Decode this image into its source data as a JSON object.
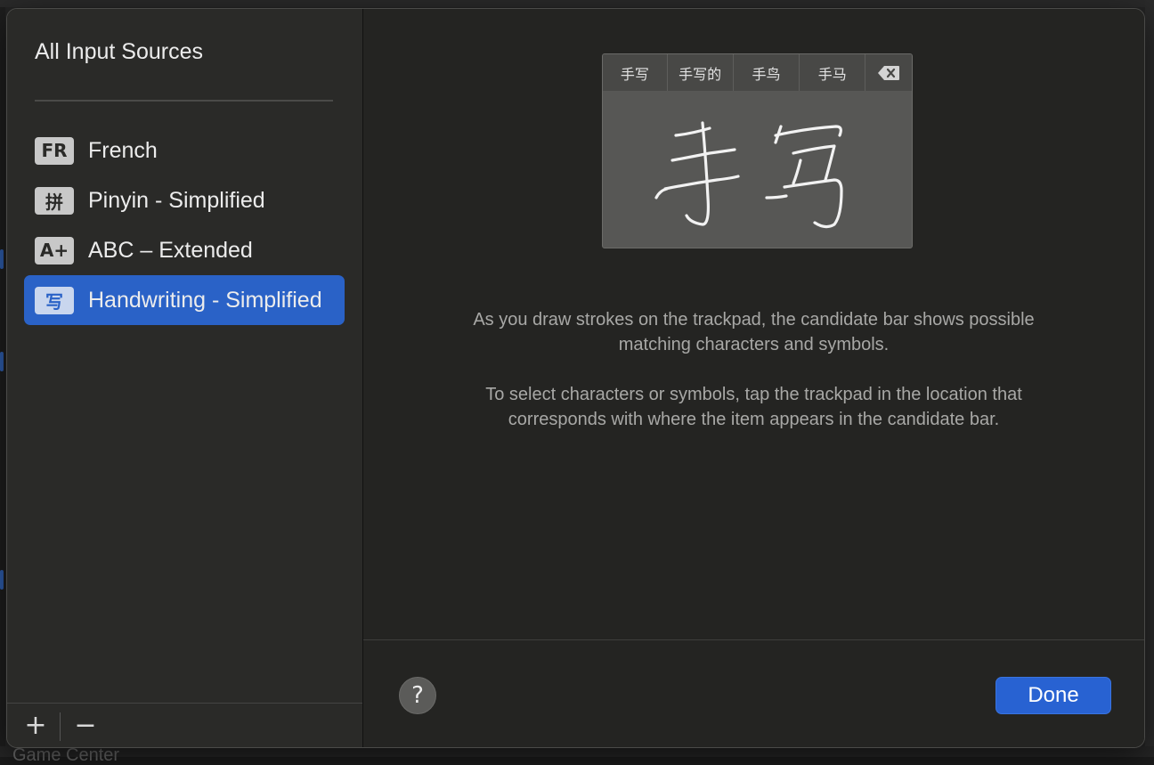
{
  "sidebar": {
    "title": "All Input Sources",
    "items": [
      {
        "badge": "FR",
        "label": "French",
        "selected": false
      },
      {
        "badge": "拼",
        "label": "Pinyin - Simplified",
        "selected": false
      },
      {
        "badge": "A+",
        "label": "ABC – Extended",
        "selected": false
      },
      {
        "badge": "写",
        "label": "Handwriting - Simplified",
        "selected": true
      }
    ],
    "add_label": "+",
    "remove_label": "−"
  },
  "preview": {
    "candidates": [
      "手写",
      "手写的",
      "手鸟",
      "手马"
    ],
    "delete_icon": "delete-left-icon",
    "handwritten_text": "手写"
  },
  "description": {
    "paragraph1": "As you draw strokes on the trackpad, the candidate bar shows possible matching characters and symbols.",
    "paragraph2": "To select characters or symbols, tap the trackpad in the location that corresponds with where the item appears in the candidate bar."
  },
  "footer": {
    "help_label": "?",
    "done_label": "Done"
  },
  "background": {
    "partial_text": "Game Center"
  },
  "colors": {
    "accent": "#2a62c7",
    "done_button": "#2862d2"
  }
}
